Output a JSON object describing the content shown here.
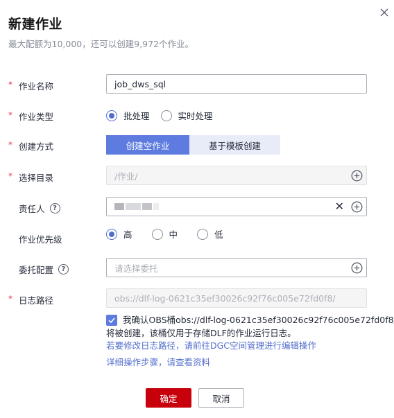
{
  "dialog": {
    "title": "新建作业",
    "subtitle": "最大配额为10,000，还可以创建9,972个作业。",
    "close_icon": "close-icon"
  },
  "form": {
    "job_name": {
      "required": "*",
      "label": "作业名称",
      "value": "job_dws_sql"
    },
    "job_type": {
      "required": "*",
      "label": "作业类型",
      "options": [
        {
          "label": "批处理",
          "checked": true
        },
        {
          "label": "实时处理",
          "checked": false
        }
      ]
    },
    "create_mode": {
      "required": "*",
      "label": "创建方式",
      "options": [
        {
          "label": "创建空作业",
          "active": true
        },
        {
          "label": "基于模板创建",
          "active": false
        }
      ]
    },
    "directory": {
      "required": "*",
      "label": "选择目录",
      "value": "/作业/",
      "icon": "plus-circle-icon"
    },
    "owner": {
      "label": "责任人",
      "help_icon": "question-circle-icon",
      "clear_icon": "clear-icon",
      "add_icon": "plus-circle-icon"
    },
    "priority": {
      "label": "作业优先级",
      "options": [
        {
          "label": "高",
          "checked": true
        },
        {
          "label": "中",
          "checked": false
        },
        {
          "label": "低",
          "checked": false
        }
      ]
    },
    "delegate": {
      "label": "委托配置",
      "help_icon": "question-circle-icon",
      "placeholder": "请选择委托",
      "icon": "plus-circle-icon"
    },
    "log_path": {
      "required": "*",
      "label": "日志路径",
      "value": "obs://dlf-log-0621c35ef30026c92f76c005e72fd0f8/",
      "confirm_line1": "我确认OBS桶obs://dlf-log-0621c35ef30026c92f76c005e72fd0f8/",
      "confirm_line2": "将被创建，该桶仅用于存储DLF的作业运行日志。",
      "confirm_checked": true,
      "modify_link": "若要修改日志路径，请前往DGC空间管理进行编辑操作",
      "detail_link": "详细操作步骤，请查看资料"
    }
  },
  "footer": {
    "confirm_label": "确定",
    "cancel_label": "取消"
  },
  "colors": {
    "primary_button": "#c7000b",
    "accent": "#5e7ce0",
    "required_star": "#e5394b",
    "link": "#526ecc"
  }
}
